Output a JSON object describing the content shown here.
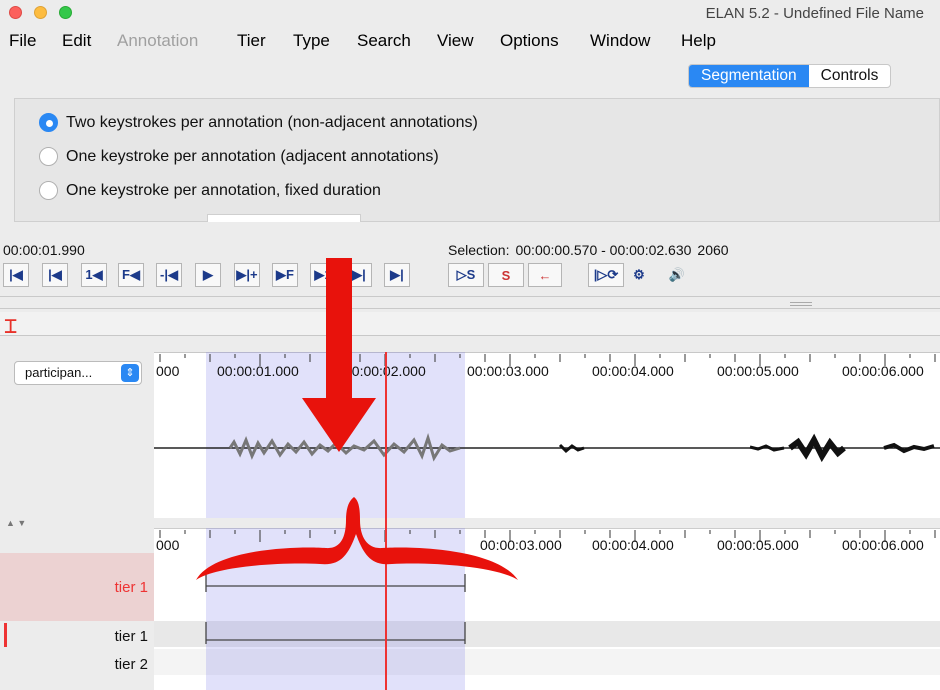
{
  "window": {
    "title": "ELAN 5.2 - Undefined File Name"
  },
  "menu": [
    "File",
    "Edit",
    "Annotation",
    "Tier",
    "Type",
    "Search",
    "View",
    "Options",
    "Window",
    "Help"
  ],
  "mode_tabs": {
    "active": "Segmentation",
    "other": "Controls"
  },
  "segmentation_options": [
    {
      "label": "Two keystrokes per annotation (non-adjacent annotations)",
      "selected": true
    },
    {
      "label": "One keystroke per annotation (adjacent annotations)",
      "selected": false
    },
    {
      "label": "One keystroke per annotation, fixed duration",
      "selected": false
    }
  ],
  "media": {
    "current_time": "00:00:01.990",
    "selection_label": "Selection:",
    "selection_range": "00:00:00.570 - 00:00:02.630",
    "selection_duration": "2060"
  },
  "transport_buttons": [
    "|◀",
    "|◀",
    "1◀",
    "F◀",
    "-|◀",
    "▶",
    "▶|+",
    "▶F",
    "▶1",
    "▶|",
    "▶|"
  ],
  "selection_buttons": [
    "▷S",
    "S",
    "←"
  ],
  "loop_buttons": [
    "|▷⟳",
    "⚙",
    "🔊"
  ],
  "waveform": {
    "tier_dropdown": "participan...",
    "ticks": [
      "000",
      "00:00:01.000",
      "00:00:02.000",
      "00:00:03.000",
      "00:00:04.000",
      "00:00:05.000",
      "00:00:06.000"
    ]
  },
  "timeline": {
    "ticks": [
      "000",
      "00:00:03.000",
      "00:00:04.000",
      "00:00:05.000",
      "00:00:06.000"
    ],
    "tiers": [
      {
        "name": "tier 1",
        "active": true
      },
      {
        "name": "tier 1",
        "active": false
      },
      {
        "name": "tier 2",
        "active": false
      }
    ]
  },
  "colors": {
    "accent": "#2a88f3",
    "crosshair": "#ee3333",
    "selection": "#d8d8f6",
    "overlay_red": "#e8120c"
  }
}
